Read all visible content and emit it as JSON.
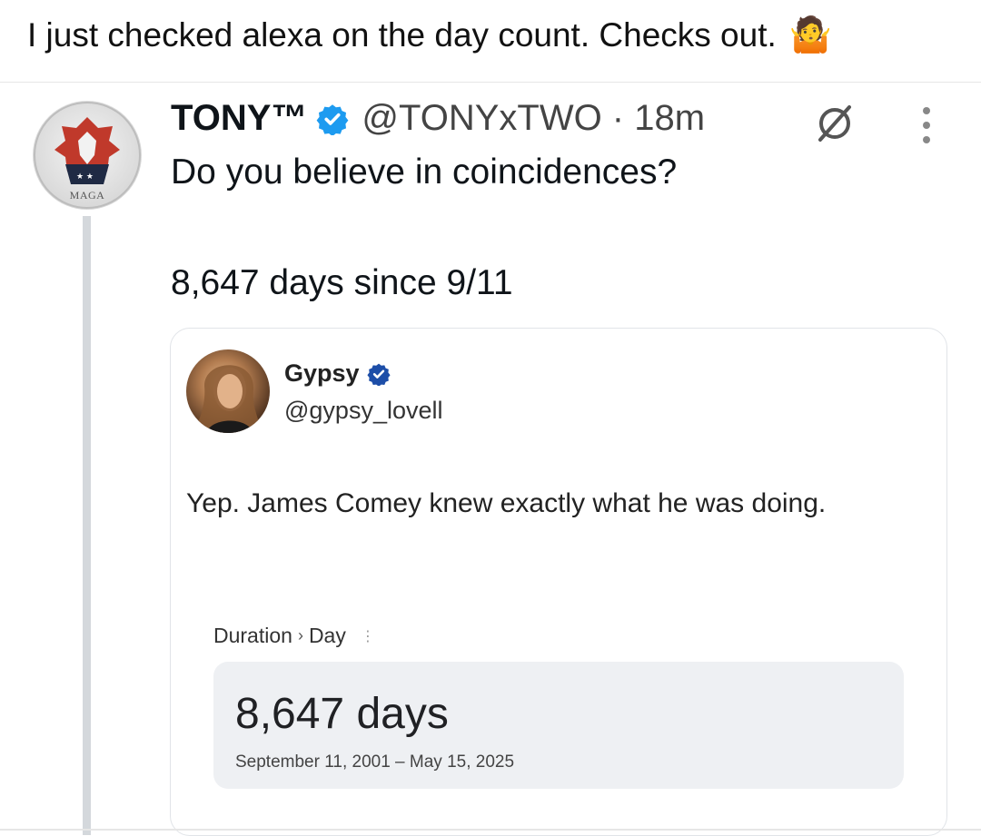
{
  "caption": {
    "text": "I just checked alexa on the day count. Checks out.",
    "emoji": "🤷"
  },
  "tweet": {
    "display_name": "TONY™",
    "handle_time": "@TONYxTWO · 18m",
    "avatar_label": "MAGA",
    "text_line1": "Do you believe in coincidences?",
    "text_line2": "8,647 days since 9/11",
    "icons": [
      "verified-badge-icon",
      "grok-icon",
      "more-options-icon"
    ]
  },
  "quote": {
    "display_name": "Gypsy",
    "handle": "@gypsy_lovell",
    "body": "Yep. James Comey knew exactly what he was doing.",
    "breadcrumb": {
      "first": "Duration",
      "separator": "›",
      "second": "Day",
      "dots": "⋮"
    },
    "result": {
      "value": "8,647 days",
      "range": "September 11, 2001 – May 15, 2025"
    }
  },
  "colors": {
    "verified": "#1d9bf0",
    "thread_line": "#d4d8dc",
    "card_border": "#e1e4e8",
    "result_bg": "#eef0f3"
  }
}
